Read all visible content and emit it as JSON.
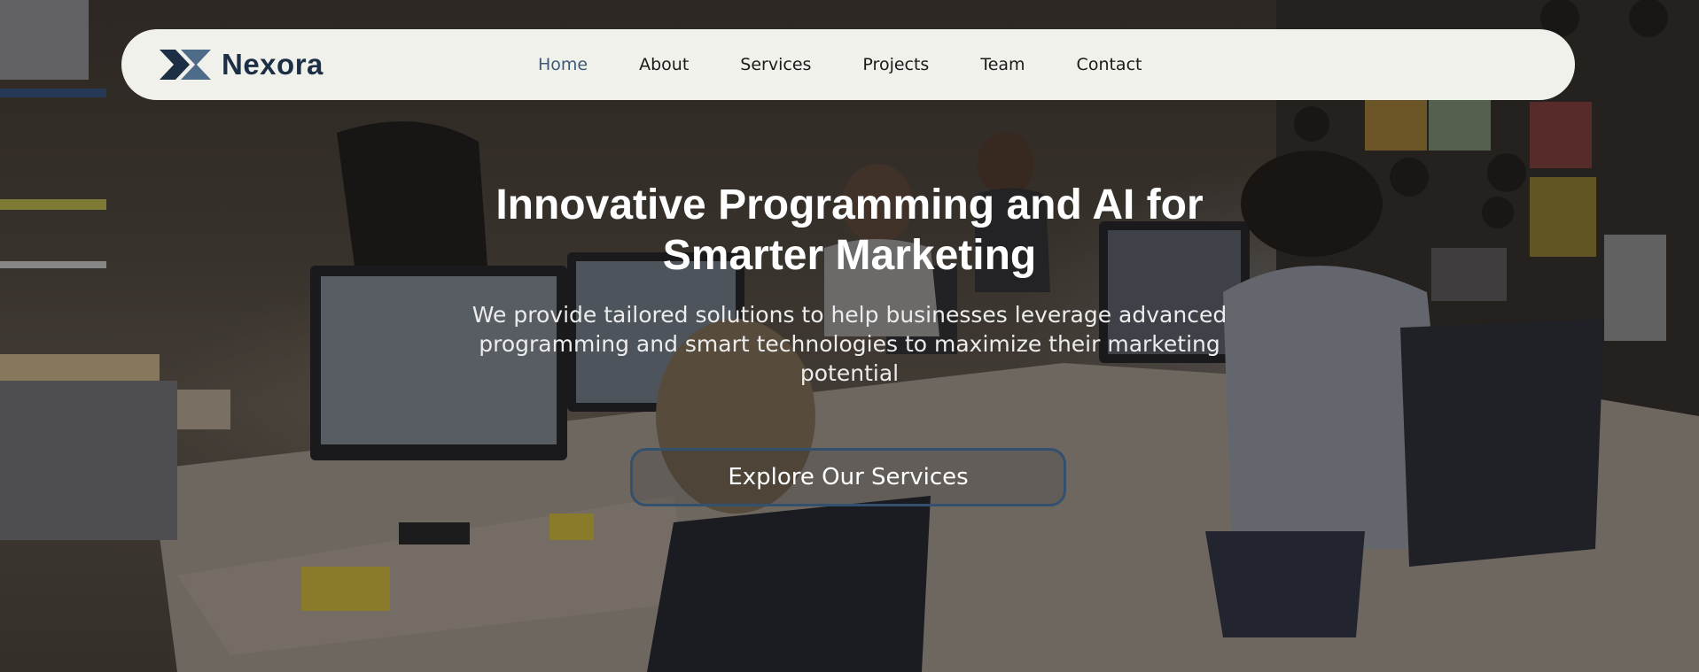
{
  "brand": {
    "name": "Nexora",
    "logo_icon": "nexora-x-logo-icon"
  },
  "nav": {
    "items": [
      {
        "label": "Home",
        "active": true
      },
      {
        "label": "About",
        "active": false
      },
      {
        "label": "Services",
        "active": false
      },
      {
        "label": "Projects",
        "active": false
      },
      {
        "label": "Team",
        "active": false
      },
      {
        "label": "Contact",
        "active": false
      }
    ]
  },
  "hero": {
    "title": "Innovative Programming and AI for Smarter Marketing",
    "subtitle": "We provide tailored solutions to help businesses leverage advanced programming and smart technologies to maximize their marketing potential",
    "cta_label": "Explore Our Services",
    "background": "office-team-working-photo"
  },
  "colors": {
    "navbar_bg": "#f1f1eb",
    "brand_text": "#1c2f45",
    "nav_active": "#3d5a7a",
    "cta_border": "#34506f",
    "logo_dark": "#1c2f45",
    "logo_light": "#4f6b8a"
  }
}
